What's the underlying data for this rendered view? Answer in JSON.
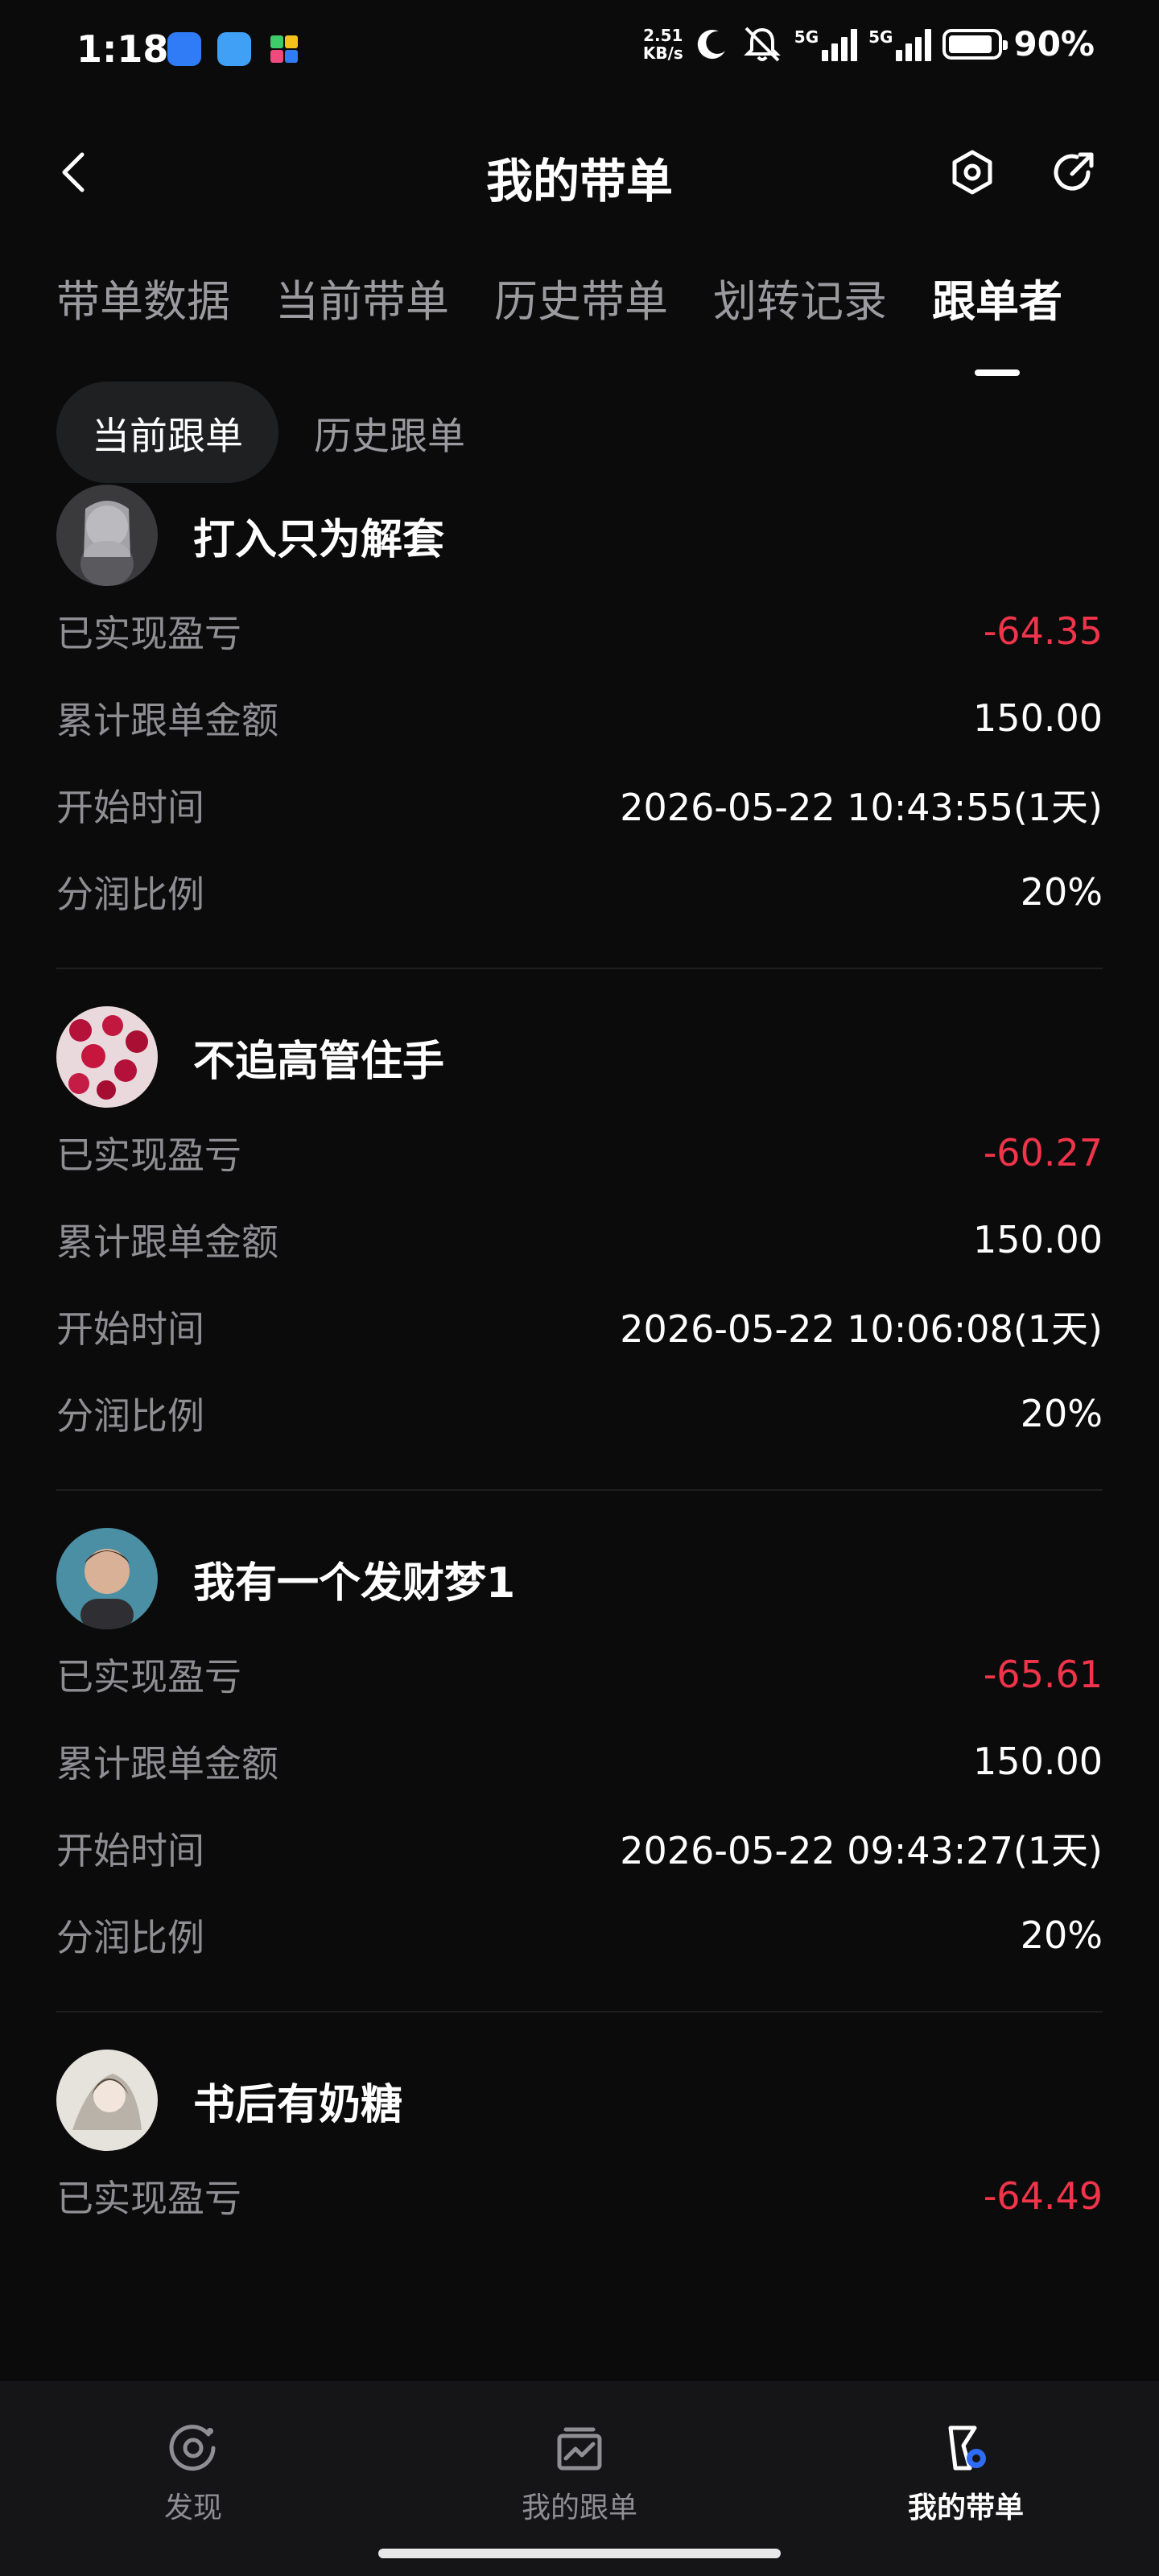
{
  "status_bar": {
    "time": "1:18",
    "net_speed_value": "2.51",
    "net_speed_unit": "KB/s",
    "signal_1": "5G",
    "signal_2": "5G",
    "battery_percent": "90%",
    "battery_level": 0.9
  },
  "header": {
    "title": "我的带单",
    "back_icon": "chevron-left-icon",
    "settings_icon": "hexagon-settings-icon",
    "share_icon": "share-arrow-icon"
  },
  "tabs": [
    {
      "label": "带单数据",
      "active": false
    },
    {
      "label": "当前带单",
      "active": false
    },
    {
      "label": "历史带单",
      "active": false
    },
    {
      "label": "划转记录",
      "active": false
    },
    {
      "label": "跟单者",
      "active": true
    }
  ],
  "subtabs": [
    {
      "label": "当前跟单",
      "active": true
    },
    {
      "label": "历史跟单",
      "active": false
    }
  ],
  "labels": {
    "pnl": "已实现盈亏",
    "total_amount": "累计跟单金额",
    "start_time": "开始时间",
    "profit_share": "分润比例"
  },
  "followers": [
    {
      "name": "打入只为解套",
      "pnl": "-64.35",
      "total_amount": "150.00",
      "start_time": "2026-05-22 10:43:55(1天)",
      "profit_share": "20%"
    },
    {
      "name": "不追高管住手",
      "pnl": "-60.27",
      "total_amount": "150.00",
      "start_time": "2026-05-22 10:06:08(1天)",
      "profit_share": "20%"
    },
    {
      "name": "我有一个发财梦1",
      "pnl": "-65.61",
      "total_amount": "150.00",
      "start_time": "2026-05-22 09:43:27(1天)",
      "profit_share": "20%"
    },
    {
      "name": "书后有奶糖",
      "pnl": "-64.49"
    }
  ],
  "bottom_nav": [
    {
      "label": "发现",
      "icon": "discover-icon",
      "active": false
    },
    {
      "label": "我的跟单",
      "icon": "chart-box-icon",
      "active": false
    },
    {
      "label": "我的带单",
      "icon": "lead-trade-icon",
      "active": true
    }
  ],
  "colors": {
    "background": "#0b0b0c",
    "negative": "#f0344a",
    "muted": "#8e8e93",
    "nav_bg": "#151517"
  }
}
